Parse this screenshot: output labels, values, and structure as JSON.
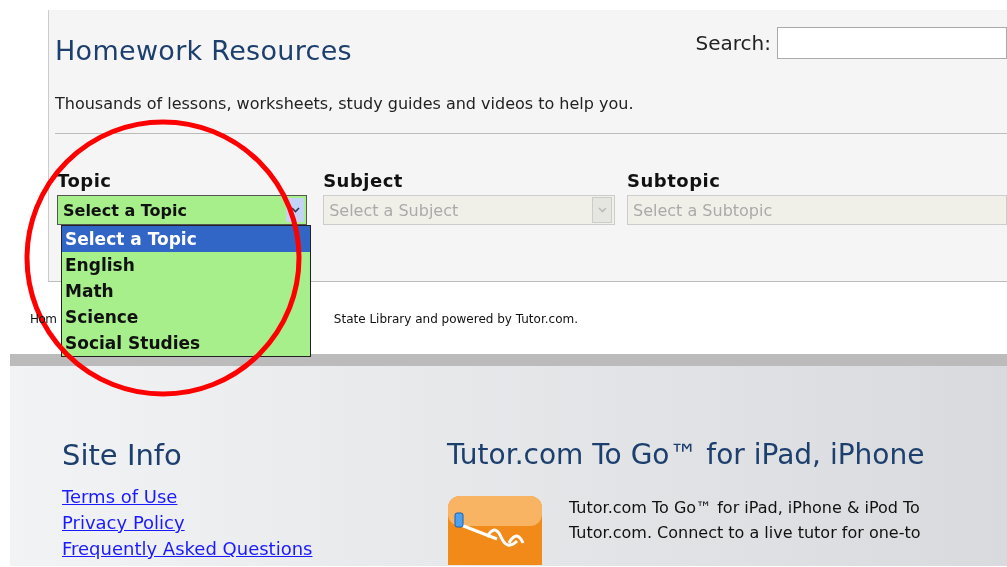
{
  "panel": {
    "title": "Homework Resources",
    "search": {
      "label": "Search:"
    },
    "intro": "Thousands of lessons, worksheets, study guides and videos to help you."
  },
  "filters": [
    {
      "label": "Topic",
      "value": "Select a Topic",
      "disabled": false,
      "expanded": true,
      "options": [
        {
          "label": "Select a Topic",
          "selected": true
        },
        {
          "label": "English",
          "selected": false
        },
        {
          "label": "Math",
          "selected": false
        },
        {
          "label": "Science",
          "selected": false
        },
        {
          "label": "Social Studies",
          "selected": false
        }
      ]
    },
    {
      "label": "Subject",
      "value": "Select a Subject",
      "disabled": true,
      "expanded": false
    },
    {
      "label": "Subtopic",
      "value": "Select a Subtopic",
      "disabled": true,
      "expanded": false
    }
  ],
  "credit": {
    "start": "Hom",
    "end": "State Library and powered by Tutor.com."
  },
  "footer": {
    "site_info": {
      "title": "Site Info",
      "links": [
        "Terms of Use",
        "Privacy Policy",
        "Frequently Asked Questions"
      ]
    },
    "app": {
      "title": "Tutor.com To Go™ for iPad, iPhone",
      "lines": [
        "Tutor.com To Go™ for iPad, iPhone & iPod To",
        "Tutor.com. Connect to a live tutor for one-to"
      ]
    }
  }
}
